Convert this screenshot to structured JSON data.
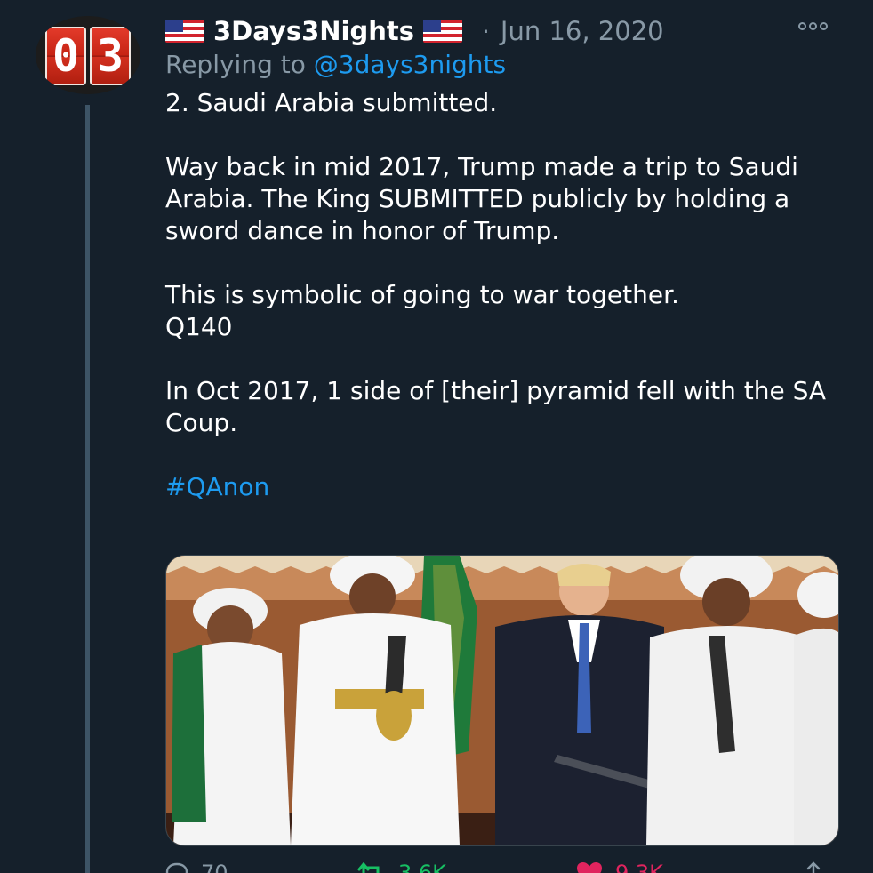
{
  "tweet": {
    "avatar_digits": [
      "0",
      "3"
    ],
    "display_name": "3Days3Nights",
    "name_flag_icons": [
      "us-flag-icon",
      "us-flag-icon"
    ],
    "separator": "·",
    "date": "Jun 16, 2020",
    "more_icon": "more-options-icon",
    "replying_prefix": "Replying to",
    "replying_handle": "@3days3nights",
    "text": {
      "line1": "2. Saudi Arabia submitted.",
      "paragraph2": "Way back in mid 2017, Trump made a trip to Saudi Arabia. The King SUBMITTED publicly by holding a sword dance in honor of Trump.",
      "paragraph3_line1": "This is symbolic of going to war together.",
      "paragraph3_line2": "Q140",
      "paragraph4": "In Oct 2017, 1 side of [their] pyramid fell with the SA Coup.",
      "hashtag": "#QAnon"
    },
    "media": {
      "kind": "photo",
      "subject_icon": "sword-dance-photo"
    },
    "actions": {
      "reply": {
        "icon": "reply-icon",
        "count": "70"
      },
      "retweet": {
        "icon": "retweet-icon",
        "count": "3.6K"
      },
      "like": {
        "icon": "heart-icon",
        "count": "9.3K"
      },
      "share": {
        "icon": "share-icon"
      }
    }
  },
  "colors": {
    "background": "#15202b",
    "text": "#ffffff",
    "secondary": "#8899a6",
    "link": "#1d9bf0",
    "retweet": "#17bf63",
    "like": "#e0245e",
    "thread_line": "#3d5466"
  }
}
